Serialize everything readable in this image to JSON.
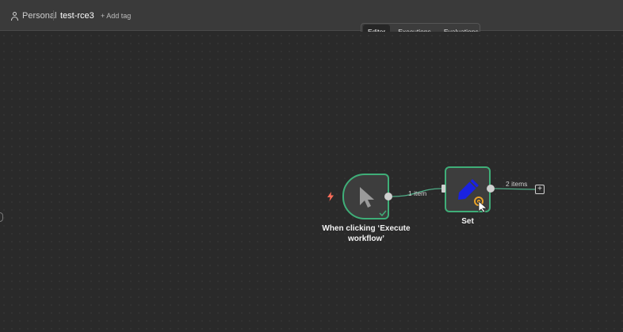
{
  "header": {
    "personal_label": "Personal",
    "workflow_name": "test-rce3",
    "add_tag_label": "+ Add tag"
  },
  "tabs": [
    {
      "label": "Editor",
      "active": true
    },
    {
      "label": "Executions",
      "active": false
    },
    {
      "label": "Evaluations",
      "active": false
    }
  ],
  "nodes": {
    "trigger": {
      "label": "When clicking ‘Execute workflow’",
      "icon": "cursor-icon"
    },
    "set": {
      "label": "Set",
      "icon": "pencil-icon"
    }
  },
  "connections": [
    {
      "label": "1 item"
    },
    {
      "label": "2 items"
    }
  ],
  "colors": {
    "node_border": "#3fae78",
    "trigger_bolt": "#ff6d5a",
    "set_icon": "#1a22e0"
  }
}
